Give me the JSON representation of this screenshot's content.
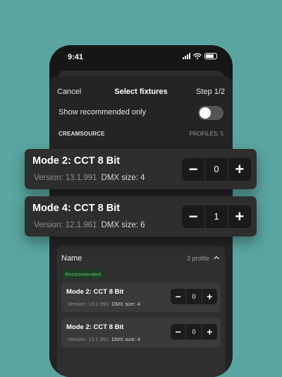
{
  "status_bar": {
    "time": "9:41"
  },
  "nav": {
    "cancel": "Cancel",
    "title": "Select fixtures",
    "step": "Step 1/2"
  },
  "filter": {
    "label": "Show recommended only",
    "enabled": false
  },
  "brand": {
    "name": "CREAMSOURCE",
    "profiles": "PROFILES: 5"
  },
  "cards": [
    {
      "name": "Mode 2: CCT 8 Bit",
      "version": "Version: 13.1.991",
      "dmx": "DMX size: 4",
      "quantity": "0"
    },
    {
      "name": "Mode 4: CCT 8 Bit",
      "version": "Version: 12.1.961",
      "dmx": "DMX size: 6",
      "quantity": "1"
    }
  ],
  "list": {
    "header": "Name",
    "count": "3 profile",
    "badge": "Recommended",
    "items": [
      {
        "name": "Mode 2: CCT 8 Bit",
        "version": "Version: 13.1.991",
        "dmx": "DMX size: 4",
        "quantity": "0"
      },
      {
        "name": "Mode 2: CCT 8 Bit",
        "version": "Version: 13.1.991",
        "dmx": "DMX size: 4",
        "quantity": "0"
      }
    ]
  },
  "colors": {
    "background": "#5aa5a0",
    "accent_green": "#4cc76a"
  }
}
